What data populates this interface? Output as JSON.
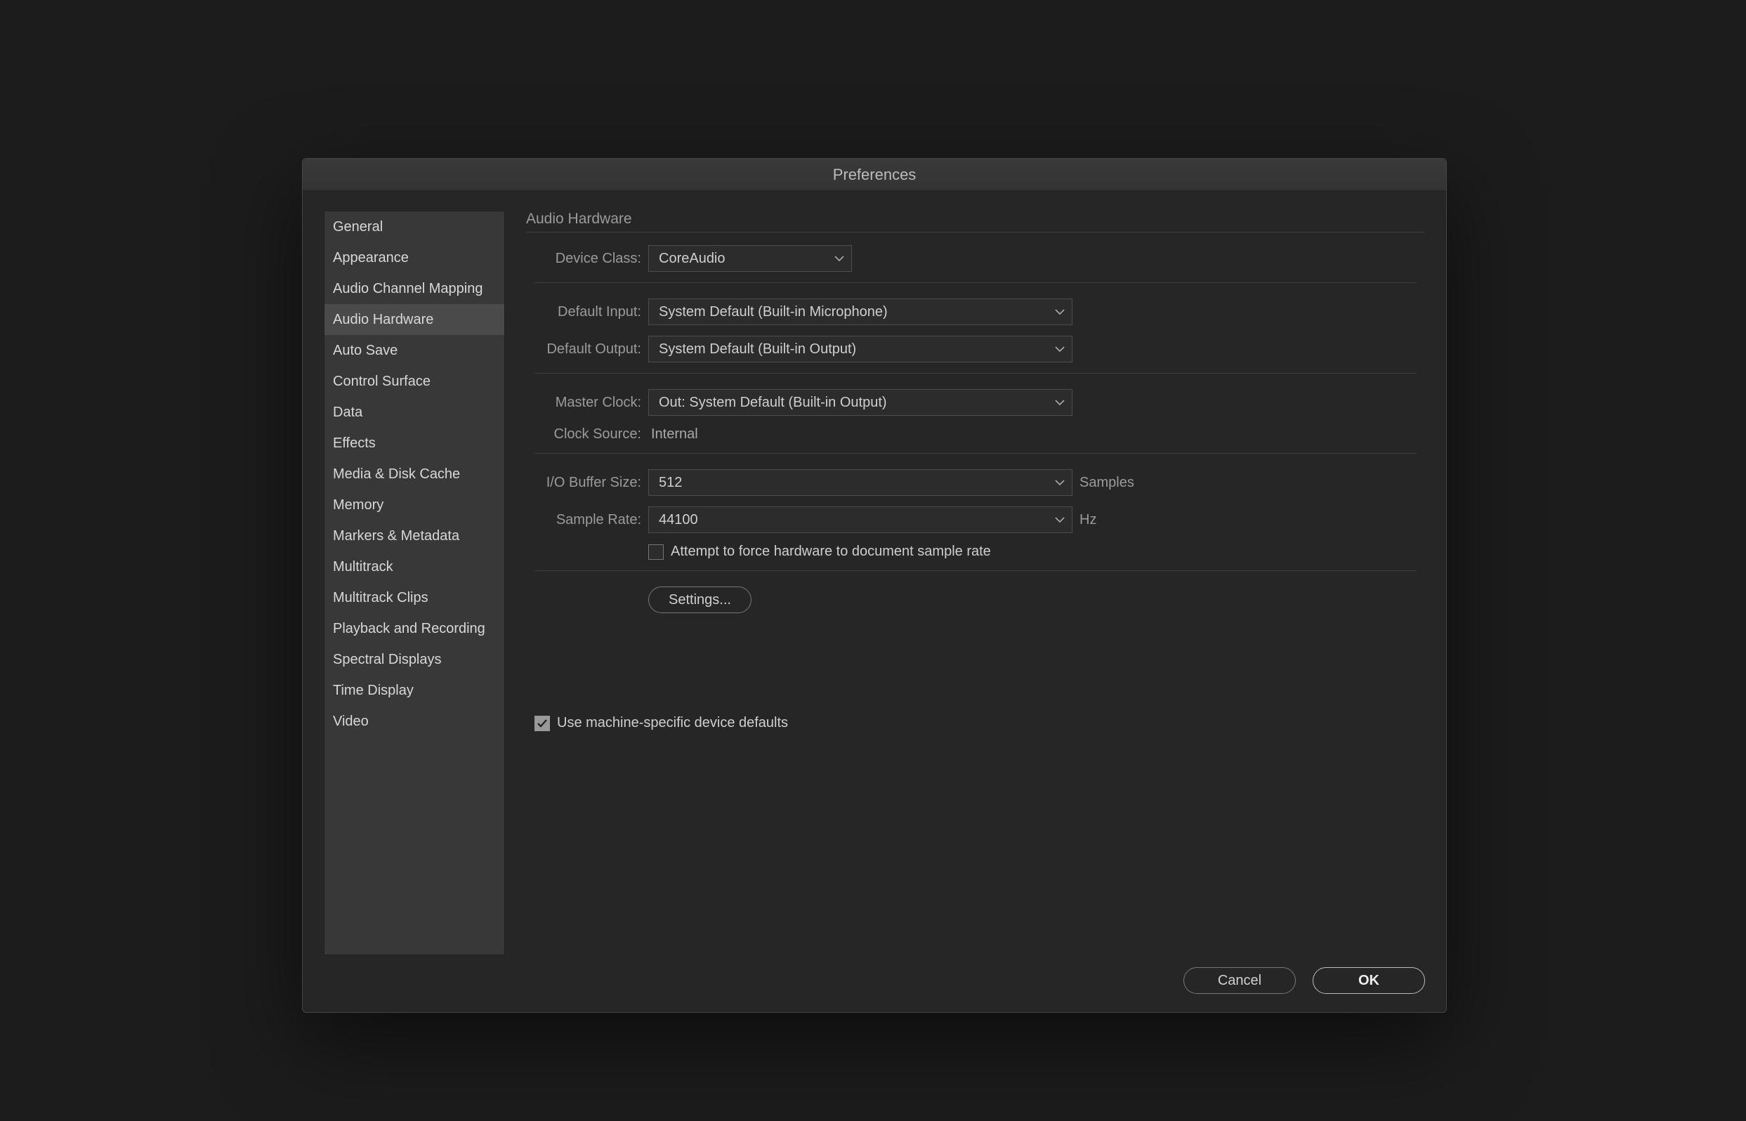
{
  "dialog": {
    "title": "Preferences"
  },
  "sidebar": {
    "items": [
      "General",
      "Appearance",
      "Audio Channel Mapping",
      "Audio Hardware",
      "Auto Save",
      "Control Surface",
      "Data",
      "Effects",
      "Media & Disk Cache",
      "Memory",
      "Markers & Metadata",
      "Multitrack",
      "Multitrack Clips",
      "Playback and Recording",
      "Spectral Displays",
      "Time Display",
      "Video"
    ],
    "selected_index": 3
  },
  "main": {
    "section_title": "Audio Hardware",
    "device_class": {
      "label": "Device Class:",
      "value": "CoreAudio"
    },
    "default_input": {
      "label": "Default Input:",
      "value": "System Default (Built-in Microphone)"
    },
    "default_output": {
      "label": "Default Output:",
      "value": "System Default (Built-in Output)"
    },
    "master_clock": {
      "label": "Master Clock:",
      "value": "Out: System Default (Built-in Output)"
    },
    "clock_source": {
      "label": "Clock Source:",
      "value": "Internal"
    },
    "io_buffer": {
      "label": "I/O Buffer Size:",
      "value": "512",
      "suffix": "Samples"
    },
    "sample_rate": {
      "label": "Sample Rate:",
      "value": "44100",
      "suffix": "Hz"
    },
    "force_checkbox": {
      "checked": false,
      "label": "Attempt to force hardware to document sample rate"
    },
    "settings_button": "Settings...",
    "machine_specific": {
      "checked": true,
      "label": "Use machine-specific device defaults"
    }
  },
  "buttons": {
    "cancel": "Cancel",
    "ok": "OK"
  }
}
